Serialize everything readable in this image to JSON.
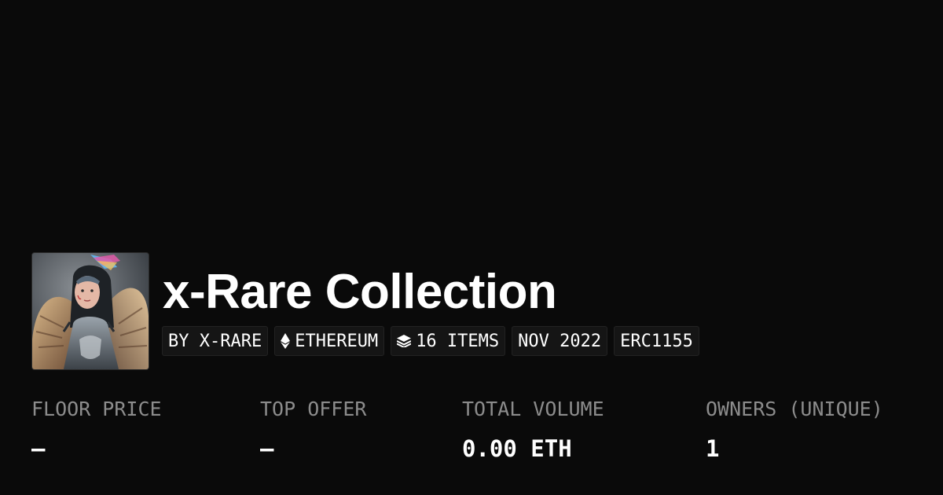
{
  "collection": {
    "title": "x-Rare Collection",
    "badges": [
      {
        "label": "BY X-RARE",
        "icon": "none"
      },
      {
        "label": "ETHEREUM",
        "icon": "ethereum-icon"
      },
      {
        "label": "16 ITEMS",
        "icon": "layers-icon"
      },
      {
        "label": "NOV 2022",
        "icon": "none"
      },
      {
        "label": "ERC1155",
        "icon": "none"
      }
    ]
  },
  "stats": [
    {
      "label": "FLOOR PRICE",
      "value": "–"
    },
    {
      "label": "TOP OFFER",
      "value": "–"
    },
    {
      "label": "TOTAL VOLUME",
      "value": "0.00 ETH"
    },
    {
      "label": "OWNERS (UNIQUE)",
      "value": "1"
    }
  ],
  "colors": {
    "background": "#0a0a0a",
    "badge_background": "#151515",
    "label": "#8c8c8c",
    "text": "#ffffff"
  }
}
